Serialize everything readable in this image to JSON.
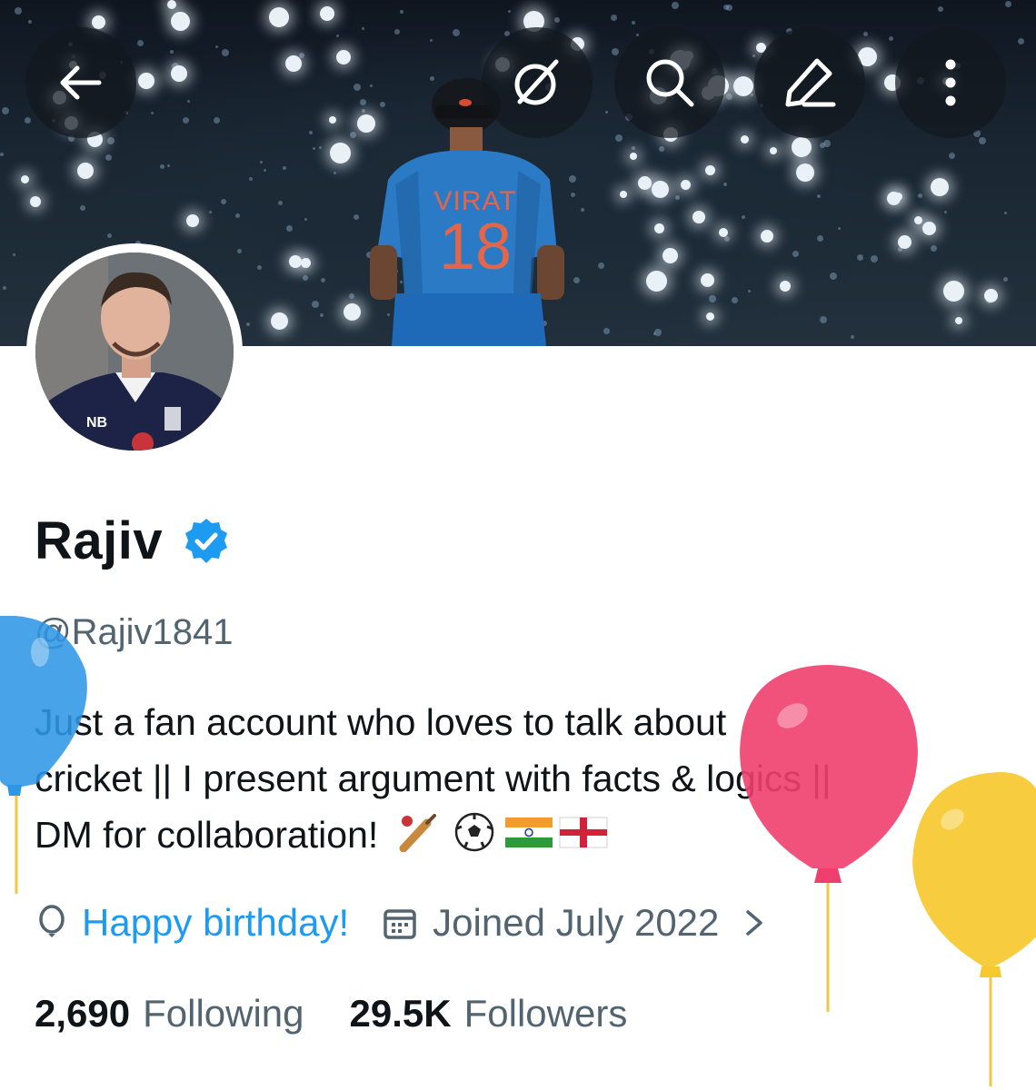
{
  "header": {
    "back_icon": "arrow-left-icon",
    "grok_icon": "grok-icon",
    "search_icon": "search-icon",
    "edit_icon": "edit-icon",
    "more_icon": "more-vertical-icon"
  },
  "banner": {
    "jersey_name": "VIRAT",
    "jersey_number": "18"
  },
  "profile": {
    "name": "Rajiv",
    "handle": "@Rajiv1841",
    "bio_line1": "Just a fan account who loves to talk about",
    "bio_line2": "cricket || I present argument with facts & logics ||",
    "bio_line3": "DM for collaboration!",
    "bio_emojis": [
      "cricket-bat-icon",
      "soccer-ball-icon",
      "india-flag-icon",
      "england-flag-icon"
    ],
    "birthday_text": "Happy birthday!",
    "joined_text": "Joined July 2022",
    "following_count": "2,690",
    "following_label": "Following",
    "followers_count": "29.5K",
    "followers_label": "Followers"
  },
  "colors": {
    "accent": "#1d9bf0",
    "text": "#0f1419",
    "muted": "#536471",
    "balloon_blue": "#2f96e6",
    "balloon_pink": "#ef3f6e",
    "balloon_yellow": "#f6c92f"
  }
}
